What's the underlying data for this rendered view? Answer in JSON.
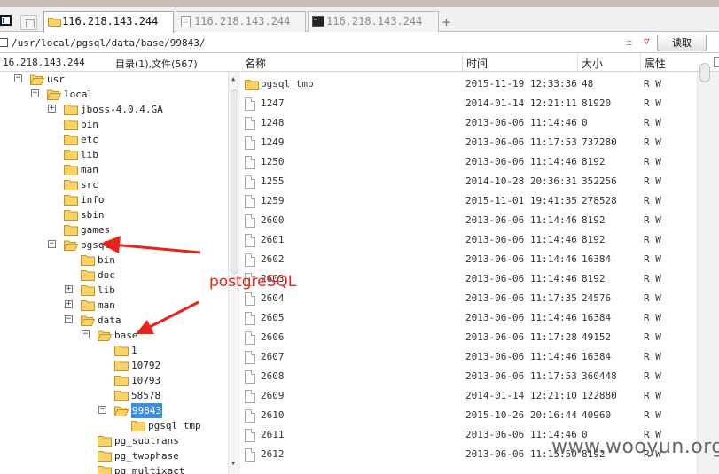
{
  "tabs": [
    {
      "label": "116.218.143.244",
      "active": true,
      "icon": "folder-icon"
    },
    {
      "label": "116.218.143.244",
      "active": false,
      "icon": "document-icon"
    },
    {
      "label": "116.218.143.244",
      "active": false,
      "icon": "terminal-icon"
    }
  ],
  "tab_add_label": "+",
  "address": {
    "path": "/usr/local/pgsql/data/base/99843/",
    "history_glyph": "±",
    "dropdown_glyph": "▽",
    "read_button": "读取"
  },
  "left_panel": {
    "host": "16.218.143.244",
    "summary": "目录(1),文件(567)"
  },
  "tree": [
    {
      "label": "usr",
      "expander": "-",
      "depth": 0
    },
    {
      "label": "local",
      "expander": "-",
      "depth": 1
    },
    {
      "label": "jboss-4.0.4.GA",
      "expander": "+",
      "depth": 2
    },
    {
      "label": "bin",
      "expander": "",
      "depth": 2
    },
    {
      "label": "etc",
      "expander": "",
      "depth": 2
    },
    {
      "label": "lib",
      "expander": "",
      "depth": 2
    },
    {
      "label": "man",
      "expander": "",
      "depth": 2
    },
    {
      "label": "src",
      "expander": "",
      "depth": 2
    },
    {
      "label": "info",
      "expander": "",
      "depth": 2
    },
    {
      "label": "sbin",
      "expander": "",
      "depth": 2
    },
    {
      "label": "games",
      "expander": "",
      "depth": 2
    },
    {
      "label": "pgsql",
      "expander": "-",
      "depth": 2
    },
    {
      "label": "bin",
      "expander": "",
      "depth": 3
    },
    {
      "label": "doc",
      "expander": "",
      "depth": 3
    },
    {
      "label": "lib",
      "expander": "+",
      "depth": 3
    },
    {
      "label": "man",
      "expander": "+",
      "depth": 3
    },
    {
      "label": "data",
      "expander": "-",
      "depth": 3
    },
    {
      "label": "base",
      "expander": "-",
      "depth": 4
    },
    {
      "label": "1",
      "expander": "",
      "depth": 5
    },
    {
      "label": "10792",
      "expander": "",
      "depth": 5
    },
    {
      "label": "10793",
      "expander": "",
      "depth": 5
    },
    {
      "label": "58578",
      "expander": "",
      "depth": 5
    },
    {
      "label": "99843",
      "expander": "-",
      "depth": 5,
      "selected": true
    },
    {
      "label": "pgsql_tmp",
      "expander": "",
      "depth": 6
    },
    {
      "label": "pg_subtrans",
      "expander": "",
      "depth": 4
    },
    {
      "label": "pg_twophase",
      "expander": "",
      "depth": 4
    },
    {
      "label": "pg_multixact",
      "expander": "",
      "depth": 4
    }
  ],
  "columns": {
    "name": "名称",
    "time": "时间",
    "size": "大小",
    "attr": "属性"
  },
  "files": [
    {
      "name": "pgsql_tmp",
      "time": "2015-11-19 12:33:36",
      "size": "48",
      "attr": "R W",
      "type": "folder"
    },
    {
      "name": "1247",
      "time": "2014-01-14 12:21:11",
      "size": "81920",
      "attr": "R W",
      "type": "file"
    },
    {
      "name": "1248",
      "time": "2013-06-06 11:14:46",
      "size": "0",
      "attr": "R W",
      "type": "file"
    },
    {
      "name": "1249",
      "time": "2013-06-06 11:17:53",
      "size": "737280",
      "attr": "R W",
      "type": "file"
    },
    {
      "name": "1250",
      "time": "2013-06-06 11:14:46",
      "size": "8192",
      "attr": "R W",
      "type": "file"
    },
    {
      "name": "1255",
      "time": "2014-10-28 20:36:31",
      "size": "352256",
      "attr": "R W",
      "type": "file"
    },
    {
      "name": "1259",
      "time": "2015-11-01 19:41:35",
      "size": "278528",
      "attr": "R W",
      "type": "file"
    },
    {
      "name": "2600",
      "time": "2013-06-06 11:14:46",
      "size": "8192",
      "attr": "R W",
      "type": "file"
    },
    {
      "name": "2601",
      "time": "2013-06-06 11:14:46",
      "size": "8192",
      "attr": "R W",
      "type": "file"
    },
    {
      "name": "2602",
      "time": "2013-06-06 11:14:46",
      "size": "16384",
      "attr": "R W",
      "type": "file"
    },
    {
      "name": "2603",
      "time": "2013-06-06 11:14:46",
      "size": "8192",
      "attr": "R W",
      "type": "file"
    },
    {
      "name": "2604",
      "time": "2013-06-06 11:17:35",
      "size": "24576",
      "attr": "R W",
      "type": "file"
    },
    {
      "name": "2605",
      "time": "2013-06-06 11:14:46",
      "size": "16384",
      "attr": "R W",
      "type": "file"
    },
    {
      "name": "2606",
      "time": "2013-06-06 11:17:28",
      "size": "49152",
      "attr": "R W",
      "type": "file"
    },
    {
      "name": "2607",
      "time": "2013-06-06 11:14:46",
      "size": "16384",
      "attr": "R W",
      "type": "file"
    },
    {
      "name": "2608",
      "time": "2013-06-06 11:17:53",
      "size": "360448",
      "attr": "R W",
      "type": "file"
    },
    {
      "name": "2609",
      "time": "2014-01-14 12:21:10",
      "size": "122880",
      "attr": "R W",
      "type": "file"
    },
    {
      "name": "2610",
      "time": "2015-10-26 20:16:44",
      "size": "40960",
      "attr": "R W",
      "type": "file"
    },
    {
      "name": "2611",
      "time": "2013-06-06 11:14:46",
      "size": "0",
      "attr": "R W",
      "type": "file"
    },
    {
      "name": "2612",
      "time": "2013-06-06 11:15:50",
      "size": "8192",
      "attr": "R W",
      "type": "file"
    }
  ],
  "annotation": {
    "label": "postgreSQL",
    "color": "#e8231b"
  },
  "watermark": "www.wooyun.org",
  "colors": {
    "folder_fill": "#f7d36b",
    "folder_stroke": "#c9951d",
    "selection": "#3a8ee6"
  }
}
